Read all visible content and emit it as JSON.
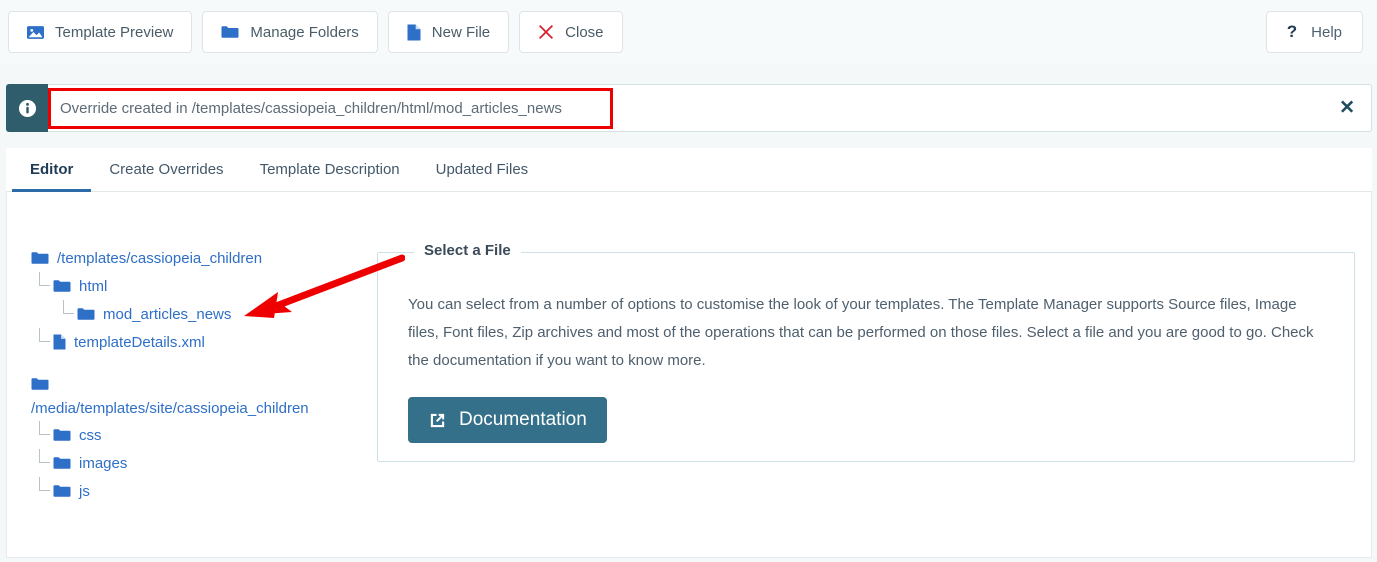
{
  "toolbar": {
    "buttons": [
      {
        "label": "Template Preview",
        "icon": "image-icon"
      },
      {
        "label": "Manage Folders",
        "icon": "folder-icon"
      },
      {
        "label": "New File",
        "icon": "file-icon"
      },
      {
        "label": "Close",
        "icon": "close-x-icon"
      }
    ],
    "help": {
      "label": "Help",
      "icon": "question-mark-icon"
    }
  },
  "alert": {
    "icon": "info-icon",
    "message": "Override created in /templates/cassiopeia_children/html/mod_articles_news",
    "close_icon": "close-x-icon"
  },
  "tabs": [
    {
      "label": "Editor",
      "active": true
    },
    {
      "label": "Create Overrides",
      "active": false
    },
    {
      "label": "Template Description",
      "active": false
    },
    {
      "label": "Updated Files",
      "active": false
    }
  ],
  "tree": {
    "root1": {
      "label": "/templates/cassiopeia_children",
      "icon": "folder-icon"
    },
    "root1_children": [
      {
        "label": "html",
        "icon": "folder-icon",
        "level": 1
      },
      {
        "label": "mod_articles_news",
        "icon": "folder-icon",
        "level": 2
      },
      {
        "label": "templateDetails.xml",
        "icon": "file-icon",
        "level": 1
      }
    ],
    "root2": {
      "label": "/media/templates/site/cassiopeia_children",
      "icon": "folder-icon"
    },
    "root2_children": [
      {
        "label": "css",
        "icon": "folder-icon",
        "level": 1
      },
      {
        "label": "images",
        "icon": "folder-icon",
        "level": 1
      },
      {
        "label": "js",
        "icon": "folder-icon",
        "level": 1
      }
    ]
  },
  "panel": {
    "legend": "Select a File",
    "paragraph": "You can select from a number of options to customise the look of your templates. The Template Manager supports Source files, Image files, Font files, Zip archives and most of the operations that can be performed on those files. Select a file and you are good to go. Check the documentation if you want to know more.",
    "doc_button": {
      "label": "Documentation",
      "icon": "external-link-icon"
    }
  },
  "annotations": {
    "rect_color": "#ef0000",
    "arrow_color": "#ef0000"
  },
  "colors": {
    "accent_blue": "#2e6fc7",
    "teal_button": "#35708a",
    "info_badge": "#2f5d6b",
    "tab_active_underline": "#2c6aa8",
    "close_red": "#d8202a"
  }
}
